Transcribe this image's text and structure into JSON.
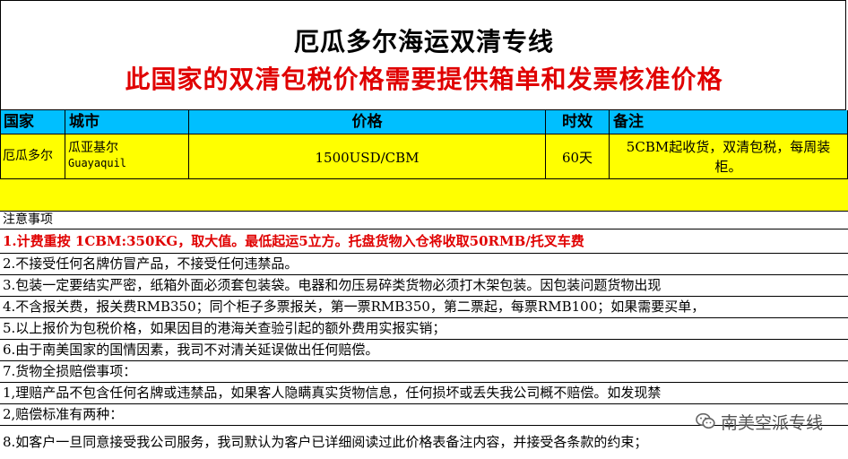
{
  "title": "厄瓜多尔海运双清专线",
  "subtitle": "此国家的双清包税价格需要提供箱单和发票核准价格",
  "table": {
    "headers": [
      "国家",
      "城市",
      "价格",
      "时效",
      "备注"
    ],
    "row": {
      "country": "厄瓜多尔",
      "city_cn": "瓜亚基尔",
      "city_en": "Guayaquil",
      "price": "1500USD/CBM",
      "time": "60天",
      "remark": "5CBM起收货，双清包税，每周装柜。"
    }
  },
  "notes_title": "注意事项",
  "notes": [
    "1.计费重按 1CBM:350KG，取大值。最低起运5立方。托盘货物入仓将收取50RMB/托叉车费",
    "2.不接受任何名牌仿冒产品，不接受任何违禁品。",
    "3.包装一定要结实严密，纸箱外面必须套包装袋。电器和勿压易碎类货物必须打木架包装。因包装问题货物出现",
    "4.不含报关费，报关费RMB350；同个柜子多票报关，第一票RMB350，第二票起，每票RMB100；如果需要买单，",
    "5.以上报价为包税价格，如果因目的港海关查验引起的额外费用实报实销；",
    "6.由于南美国家的国情因素，我司不对清关延误做出任何赔偿。",
    "7.货物全损赔偿事项：",
    "1,理赔产品不包含任何名牌或违禁品，如果客人隐瞒真实货物信息，任何损坏或丢失我公司概不赔偿。如发现禁",
    "2,赔偿标准有两种：",
    "8.如客户一旦同意接受我公司服务，我司默认为客户已详细阅读过此价格表备注内容，并接受各条款的约束；"
  ],
  "watermark": "南美空派专线",
  "icons": {
    "watermark": "wechat-icon"
  },
  "colors": {
    "header_bg": "#00bfff",
    "row_bg": "#ffff00",
    "accent_red": "#e00000"
  }
}
